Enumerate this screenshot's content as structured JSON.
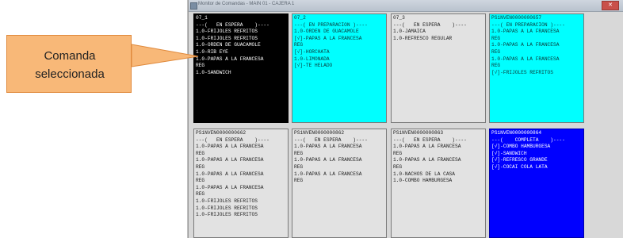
{
  "window": {
    "title": "Monitor de Comandas - MAIN 01 - CAJERA 1"
  },
  "callout": {
    "line1": "Comanda",
    "line2": "seleccionada"
  },
  "colors": {
    "selected": "#000000",
    "in_preparation": "#00ffff",
    "waiting": "#e2e2e2",
    "complete": "#0000ff",
    "callout": "#f8b878"
  },
  "orders": [
    {
      "status": "selected",
      "lines": [
        "07_1",
        "---(   EN ESPERA    )----",
        "1.0-FRIJOLES REFRITOS",
        "1.0-FRIJOLES REFRITOS",
        "1.0-ORDEN DE GUACAMOLE",
        "1.0-RIB EYE",
        "1.0-PAPAS A LA FRANCESA",
        "REG",
        "1.0-SANDWICH"
      ]
    },
    {
      "status": "in_preparation",
      "lines": [
        "07_2",
        "---( EN PREPARACION )----",
        "1.0-ORDEN DE GUACAMOLE",
        "[√]-PAPAS A LA FRANCESA",
        "REG",
        "[√]-HORCHATA",
        "1.0-LIMONADA",
        "[√]-TE HELADO"
      ]
    },
    {
      "status": "waiting",
      "lines": [
        "07_3",
        "---(   EN ESPERA    )----",
        "1.0-JAMAICA",
        "1.0-REFRESCO REGULAR"
      ]
    },
    {
      "status": "in_preparation",
      "lines": [
        "PS1NVEN0000000657",
        "---( EN PREPARACION )----",
        "1.0-PAPAS A LA FRANCESA",
        "REG",
        "1.0-PAPAS A LA FRANCESA",
        "REG",
        "1.0-PAPAS A LA FRANCESA",
        "REG",
        "[√]-FRIJOLES REFRITOS"
      ]
    },
    {
      "status": "waiting",
      "lines": [
        "PS1NVEN0000000662",
        "---(   EN ESPERA    )----",
        "1.0-PAPAS A LA FRANCESA",
        "REG",
        "1.0-PAPAS A LA FRANCESA",
        "REG",
        "1.0-PAPAS A LA FRANCESA",
        "REG",
        "1.0-PAPAS A LA FRANCESA",
        "REG",
        "1.0-FRIJOLES REFRITOS",
        "1.0-FRIJOLES REFRITOS",
        "1.0-FRIJOLES REFRITOS"
      ]
    },
    {
      "status": "waiting",
      "lines": [
        "PS1NVEN0000000862",
        "---(   EN ESPERA    )----",
        "1.0-PAPAS A LA FRANCESA",
        "REG",
        "1.0-PAPAS A LA FRANCESA",
        "REG",
        "1.0-PAPAS A LA FRANCESA",
        "REG"
      ]
    },
    {
      "status": "waiting",
      "lines": [
        "PS1NVEN0000000863",
        "---(   EN ESPERA    )----",
        "1.0-PAPAS A LA FRANCESA",
        "REG",
        "1.0-PAPAS A LA FRANCESA",
        "REG",
        "1.0-NACHOS DE LA CASA",
        "1.0-COMBO HAMBURGESA"
      ]
    },
    {
      "status": "complete",
      "lines": [
        "PS1NVEN0000000864",
        "---(    COMPLETA    )----",
        "[√]-COMBO HAMBURGESA",
        "[√]-SANDWICH",
        "[√]-REFRESCO GRANDE",
        "[√]-COCAI COLA LATA"
      ]
    }
  ]
}
